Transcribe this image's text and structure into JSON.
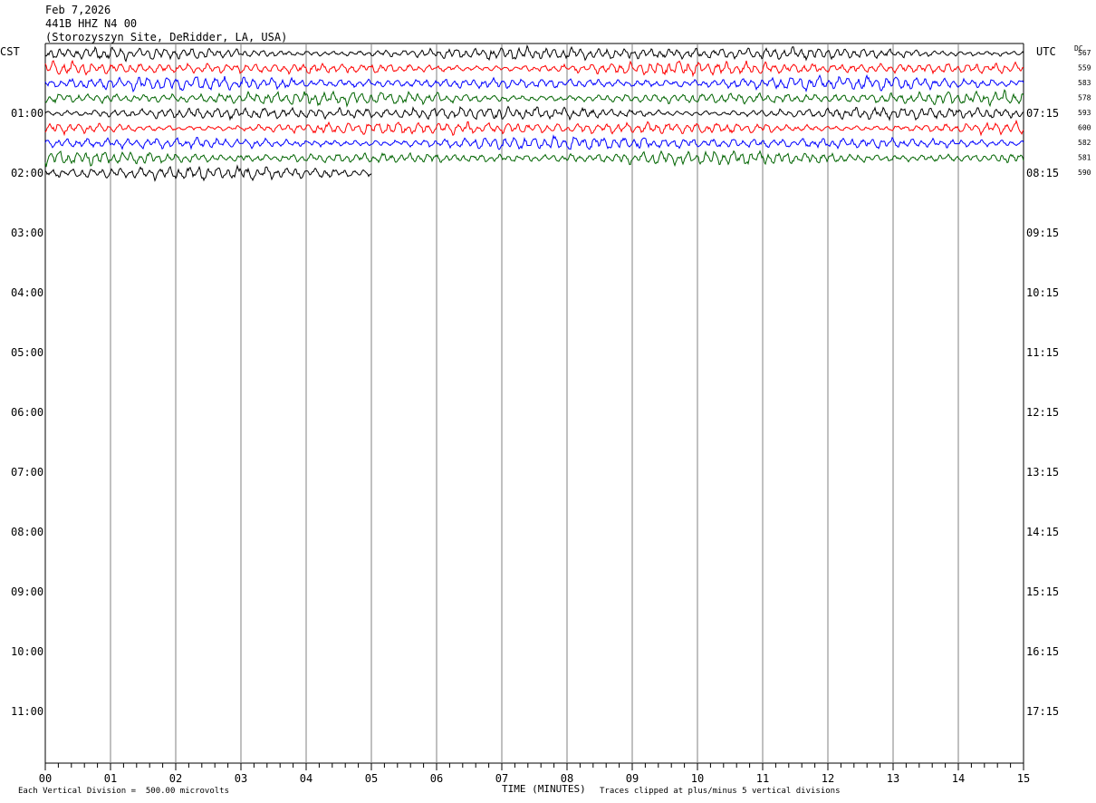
{
  "header": {
    "date": "Feb 7,2026",
    "channel": "441B HHZ N4 00",
    "site": "(Storozyszyn Site, DeRidder, LA, USA)"
  },
  "labels": {
    "left_zone": "CST",
    "right_zone": "UTC",
    "dc_label": "DC"
  },
  "footer": {
    "xlabel": "TIME (MINUTES)",
    "scale_note": "Each Vertical Division =  500.00 microvolts",
    "clip_note": "Traces clipped at plus/minus 5 vertical divisions"
  },
  "chart_data": {
    "type": "line",
    "title": "441B HHZ N4 00",
    "xlabel": "TIME (MINUTES)",
    "ylabel": "",
    "xlim": [
      0,
      15
    ],
    "x_ticks": [
      "00",
      "01",
      "02",
      "03",
      "04",
      "05",
      "06",
      "07",
      "08",
      "09",
      "10",
      "11",
      "12",
      "13",
      "14",
      "15"
    ],
    "hour_labels_cst": [
      "01:00",
      "02:00",
      "03:00",
      "04:00",
      "05:00",
      "06:00",
      "07:00",
      "08:00",
      "09:00",
      "10:00",
      "11:00"
    ],
    "hour_labels_utc": [
      "07:15",
      "08:15",
      "09:15",
      "10:15",
      "11:15",
      "12:15",
      "13:15",
      "14:15",
      "15:15",
      "16:15",
      "17:15"
    ],
    "trace_colors": [
      "#000000",
      "#ff0000",
      "#0000ff",
      "#006400"
    ],
    "traces": [
      {
        "dc": "567",
        "color": "#000000",
        "end_minute": 15
      },
      {
        "dc": "559",
        "color": "#ff0000",
        "end_minute": 15
      },
      {
        "dc": "583",
        "color": "#0000ff",
        "end_minute": 15
      },
      {
        "dc": "578",
        "color": "#006400",
        "end_minute": 15
      },
      {
        "dc": "593",
        "color": "#000000",
        "end_minute": 15
      },
      {
        "dc": "600",
        "color": "#ff0000",
        "end_minute": 15
      },
      {
        "dc": "582",
        "color": "#0000ff",
        "end_minute": 15
      },
      {
        "dc": "581",
        "color": "#006400",
        "end_minute": 15
      },
      {
        "dc": "590",
        "color": "#000000",
        "end_minute": 5
      }
    ],
    "grid": true
  }
}
